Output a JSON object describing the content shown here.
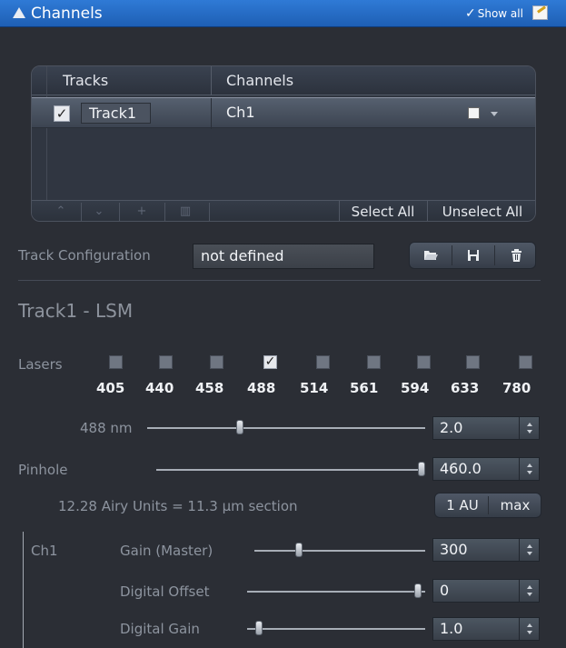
{
  "titlebar": {
    "title": "Channels",
    "show_all": "Show all",
    "check": "✓"
  },
  "table": {
    "headers": {
      "tracks": "Tracks",
      "channels": "Channels"
    },
    "rows": [
      {
        "checked": "✓",
        "track": "Track1",
        "channel": "Ch1"
      }
    ],
    "footer": {
      "add": "+",
      "select_all": "Select All",
      "unselect_all": "Unselect All"
    }
  },
  "track_config": {
    "label": "Track Configuration",
    "value": "not defined"
  },
  "section_title": "Track1 - LSM",
  "lasers": {
    "label": "Lasers",
    "items": [
      {
        "wavelength": "405",
        "checked": false
      },
      {
        "wavelength": "440",
        "checked": false
      },
      {
        "wavelength": "458",
        "checked": false
      },
      {
        "wavelength": "488",
        "checked": true,
        "mark": "✓"
      },
      {
        "wavelength": "514",
        "checked": false
      },
      {
        "wavelength": "561",
        "checked": false
      },
      {
        "wavelength": "594",
        "checked": false
      },
      {
        "wavelength": "633",
        "checked": false
      },
      {
        "wavelength": "780",
        "checked": false
      }
    ]
  },
  "laser_power": {
    "label": "488 nm",
    "value": "2.0",
    "level": 0.33
  },
  "pinhole": {
    "label": "Pinhole",
    "value": "460.0",
    "level": 1.0,
    "airy_text": "12.28 Airy Units  =  11.3 µm section",
    "btn_1au": "1 AU",
    "btn_max": "max"
  },
  "channel": {
    "name": "Ch1",
    "gain": {
      "label": "Gain (Master)",
      "value": "300",
      "level": 0.25
    },
    "offset": {
      "label": "Digital Offset",
      "value": "0",
      "level": 0.98
    },
    "digital_gain": {
      "label": "Digital Gain",
      "value": "1.0",
      "level": 0.05
    }
  },
  "colors": {
    "titlebar": "#2f7ad6",
    "background": "#2b2e35"
  }
}
